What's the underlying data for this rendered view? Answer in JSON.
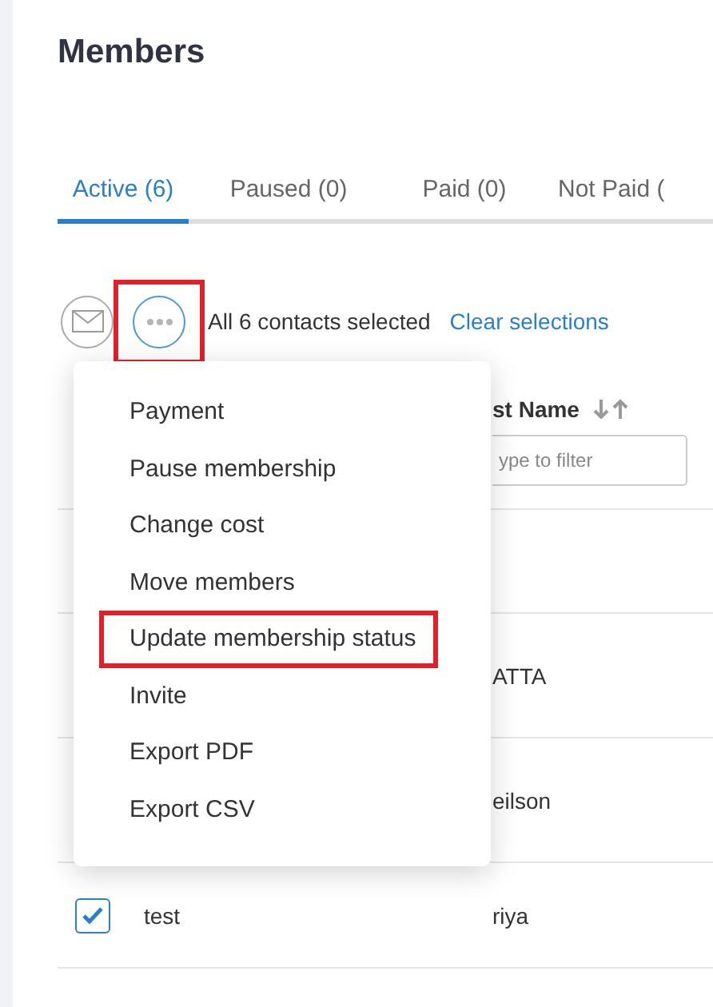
{
  "page": {
    "title": "Members"
  },
  "tabs": [
    {
      "label": "Active (6)",
      "selected": true
    },
    {
      "label": "Paused (0)",
      "selected": false
    },
    {
      "label": "Paid (0)",
      "selected": false
    },
    {
      "label": "Not Paid (",
      "selected": false
    }
  ],
  "toolbar": {
    "more_highlighted": true,
    "selection_text": "All 6 contacts selected",
    "clear_link": "Clear selections"
  },
  "table": {
    "column_2_header": "st Name",
    "filter_placeholder": "ype to filter",
    "rows": [
      {
        "column_2": "ATTA"
      },
      {
        "column_2": "eilson"
      },
      {
        "checked": true,
        "column_1": "test",
        "column_2": "riya"
      }
    ]
  },
  "menu": {
    "items": [
      {
        "label": "Payment",
        "highlighted": false
      },
      {
        "label": "Pause membership",
        "highlighted": false
      },
      {
        "label": "Change cost",
        "highlighted": false
      },
      {
        "label": "Move members",
        "highlighted": false
      },
      {
        "label": "Update membership status",
        "highlighted": true
      },
      {
        "label": "Invite",
        "highlighted": false
      },
      {
        "label": "Export PDF",
        "highlighted": false
      },
      {
        "label": "Export CSV",
        "highlighted": false
      }
    ]
  }
}
